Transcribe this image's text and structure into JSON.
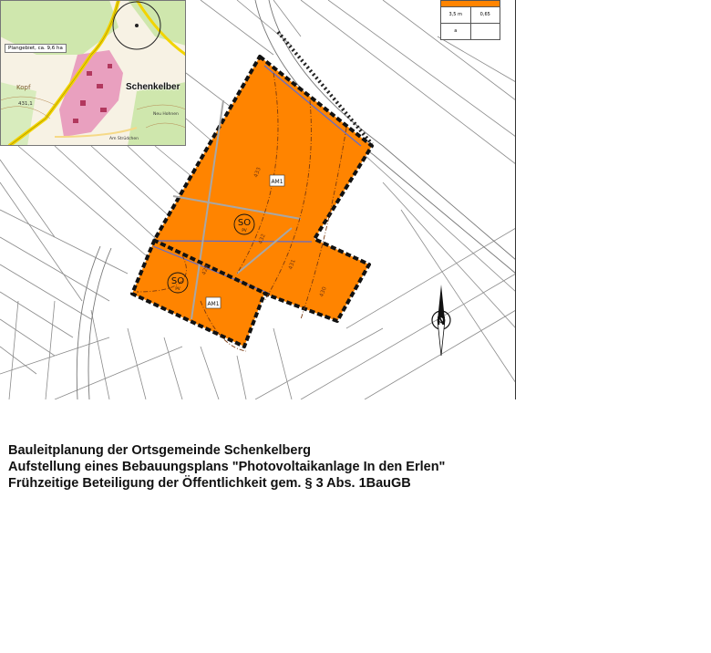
{
  "map": {
    "inset": {
      "place_name": "Schenkelber",
      "plan_area_label": "Plangebiet, ca. 9,6 ha",
      "hill_label": "Kopf",
      "hill_height": "431,1",
      "small_label_1": "Neu Hohnen",
      "small_label_2": "Am Strüdchen"
    },
    "legend": {
      "height_value": "3,5 m",
      "grz_value": "0,65",
      "cell_a": "a"
    },
    "zones": [
      {
        "label": "SO",
        "sub": "PV"
      },
      {
        "label": "SO",
        "sub": "PV"
      }
    ],
    "am_labels": [
      "AM1",
      "AM1"
    ],
    "contour_labels": [
      "433",
      "432",
      "431",
      "430",
      "429"
    ],
    "north_arrow": "N",
    "colors": {
      "plan_area": "#ff8400",
      "border": "#111111",
      "inset_pink": "#e9a0bf",
      "inset_green": "#c9e6a4",
      "road_yellow": "#f2d400"
    }
  },
  "caption": {
    "line1": "Bauleitplanung der Ortsgemeinde Schenkelberg",
    "line2": "Aufstellung eines Bebauungsplans \"Photovoltaikanlage In den Erlen\"",
    "line3": "Frühzeitige Beteiligung der Öffentlichkeit gem. § 3 Abs. 1BauGB"
  }
}
